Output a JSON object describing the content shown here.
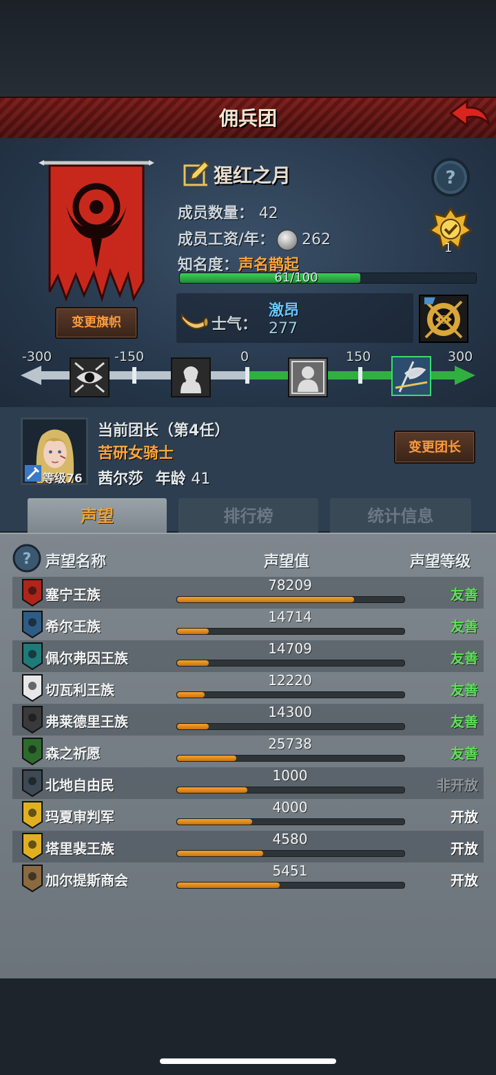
{
  "header": {
    "title": "佣兵团"
  },
  "guild": {
    "name": "猩红之月",
    "members_label": "成员数量：",
    "members": "42",
    "wage_label": "成员工资/年：",
    "wage": "262",
    "fame_label": "知名度：",
    "fame_title": "声名鹊起",
    "fame_progress": "61/100",
    "fame_fraction": 0.61,
    "rank": "1",
    "change_banner_label": "变更旗帜"
  },
  "morale": {
    "label": "士气：",
    "state": "激昂",
    "value": "277",
    "scale": [
      "-300",
      "-150",
      "0",
      "150",
      "300"
    ]
  },
  "leader": {
    "title": "当前团长（第4任）",
    "class": "苦研女骑士",
    "name": "茜尔莎",
    "age_label": "年龄",
    "age": "41",
    "level": "等级76",
    "change_label": "变更团长"
  },
  "tabs": [
    {
      "label": "声望",
      "active": true
    },
    {
      "label": "排行榜",
      "active": false
    },
    {
      "label": "统计信息",
      "active": false
    }
  ],
  "table": {
    "headers": {
      "name": "声望名称",
      "value": "声望值",
      "level": "声望等级"
    },
    "rows": [
      {
        "name": "塞宁王族",
        "value": "78209",
        "fill": 0.78,
        "level": "友善",
        "color": "#5fe05a",
        "icon": "red-crest-icon"
      },
      {
        "name": "希尔王族",
        "value": "14714",
        "fill": 0.14,
        "level": "友善",
        "color": "#5fe05a",
        "icon": "blue-helm-icon"
      },
      {
        "name": "佩尔弗因王族",
        "value": "14709",
        "fill": 0.14,
        "level": "友善",
        "color": "#5fe05a",
        "icon": "teal-wave-icon"
      },
      {
        "name": "切瓦利王族",
        "value": "12220",
        "fill": 0.12,
        "level": "友善",
        "color": "#5fe05a",
        "icon": "scales-icon"
      },
      {
        "name": "弗莱德里王族",
        "value": "14300",
        "fill": 0.14,
        "level": "友善",
        "color": "#5fe05a",
        "icon": "dark-mask-icon"
      },
      {
        "name": "森之祈愿",
        "value": "25738",
        "fill": 0.26,
        "level": "友善",
        "color": "#5fe05a",
        "icon": "tree-icon"
      },
      {
        "name": "北地自由民",
        "value": "1000",
        "fill": 0.31,
        "level": "非开放",
        "color": "#8d969b",
        "icon": "axe-icon"
      },
      {
        "name": "玛夏审判军",
        "value": "4000",
        "fill": 0.33,
        "level": "开放",
        "color": "#ffffff",
        "icon": "yellow-cross-icon"
      },
      {
        "name": "塔里裴王族",
        "value": "4580",
        "fill": 0.38,
        "level": "开放",
        "color": "#ffffff",
        "icon": "crown-icon"
      },
      {
        "name": "加尔提斯商会",
        "value": "5451",
        "fill": 0.45,
        "level": "开放",
        "color": "#ffffff",
        "icon": "chest-icon"
      }
    ]
  }
}
